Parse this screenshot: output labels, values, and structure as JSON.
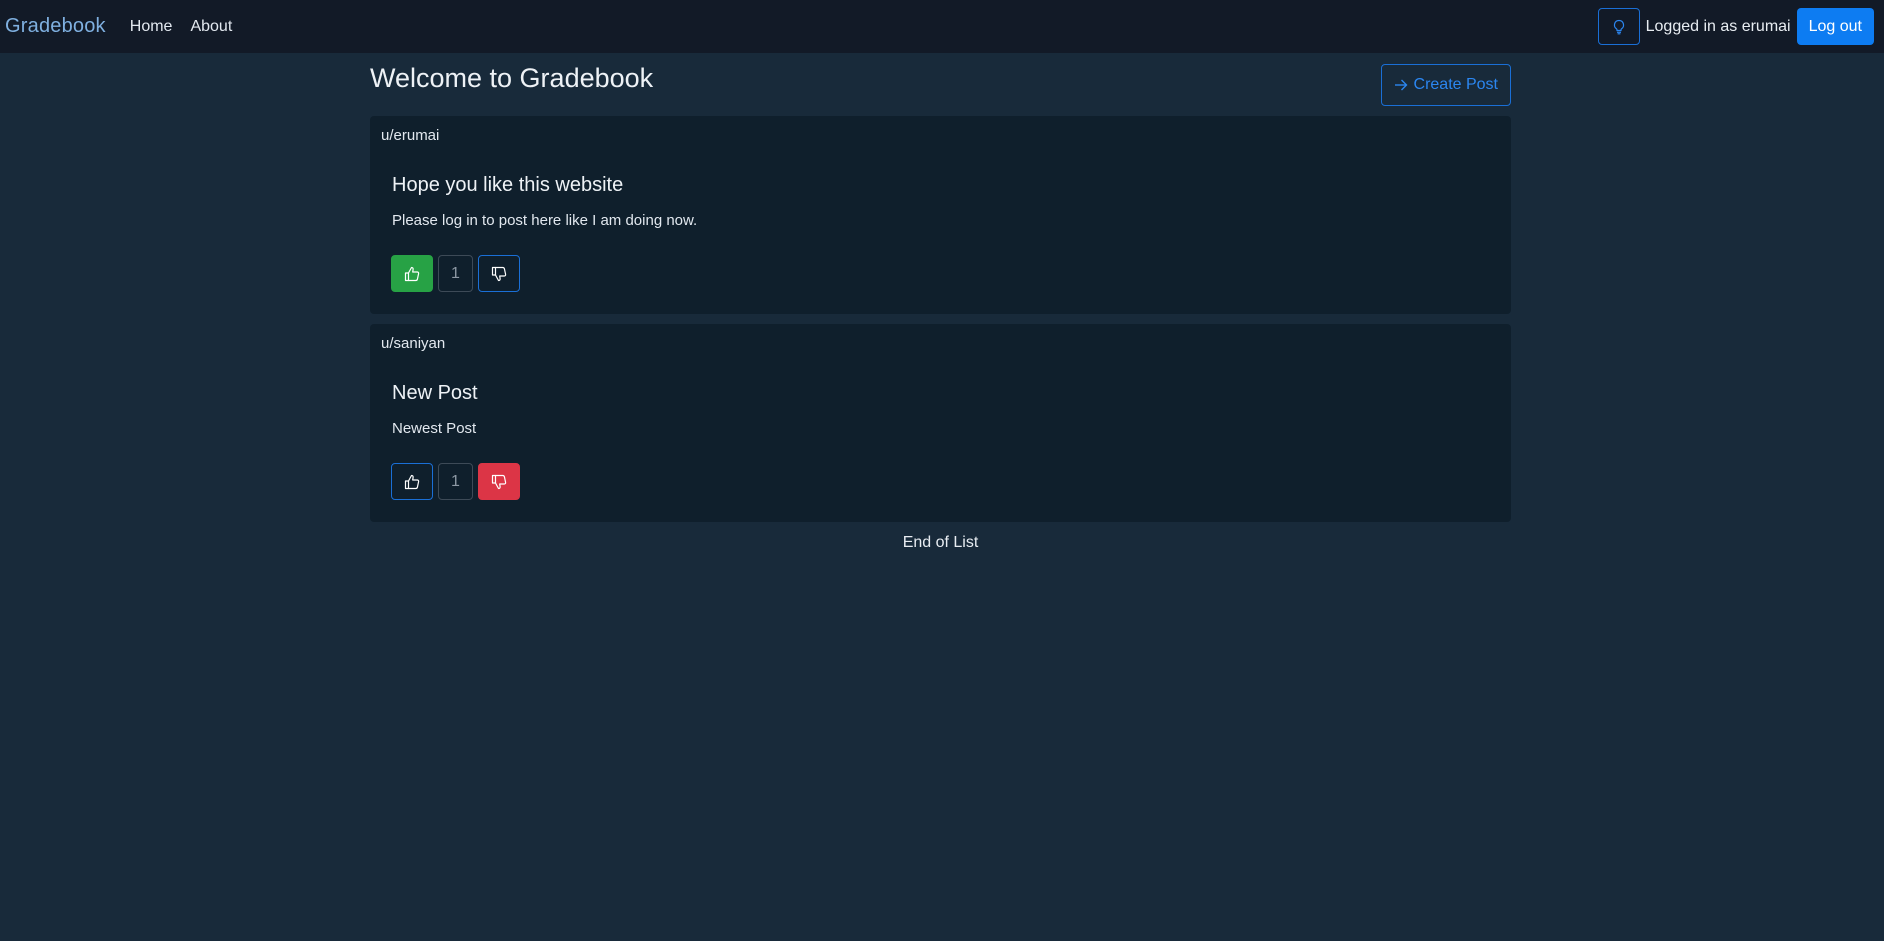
{
  "navbar": {
    "brand": "Gradebook",
    "links": [
      {
        "label": "Home"
      },
      {
        "label": "About"
      }
    ],
    "theme_icon": "lightbulb-icon",
    "logged_in_text": "Logged in as erumai",
    "logout_label": "Log out"
  },
  "main": {
    "title": "Welcome to Gradebook",
    "create_post_label": "Create Post",
    "create_post_icon": "arrow-right-icon",
    "posts": [
      {
        "author": "u/erumai",
        "title": "Hope you like this website",
        "body": "Please log in to post here like I am doing now.",
        "votes": "1",
        "vote_state": "up"
      },
      {
        "author": "u/saniyan",
        "title": "New Post",
        "body": "Newest Post",
        "votes": "1",
        "vote_state": "down"
      }
    ],
    "end_text": "End of List"
  },
  "colors": {
    "background": "#182a3a",
    "navbar": "#121a27",
    "card": "#0f1f2c",
    "primary": "#0d7cf2",
    "success": "#27a245",
    "danger": "#dc3546"
  }
}
